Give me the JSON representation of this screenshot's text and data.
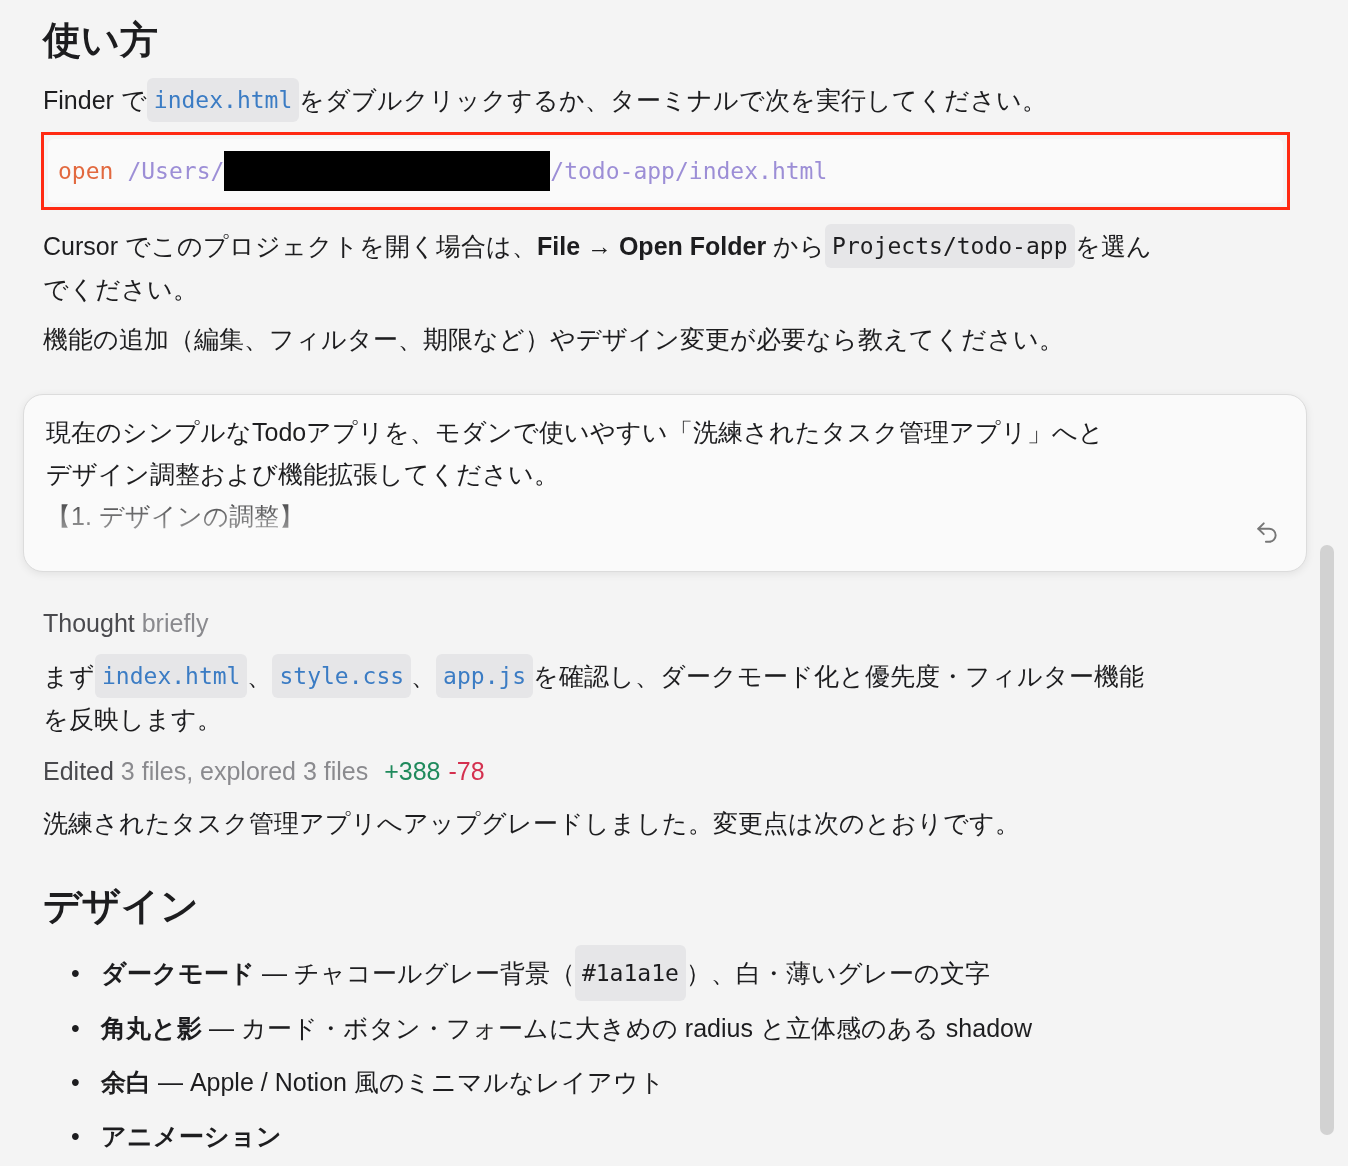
{
  "usage": {
    "heading": "使い方",
    "intro": [
      [
        {
          "kind": "text",
          "text": "Finder で "
        },
        {
          "kind": "code",
          "text": "index.html"
        },
        {
          "kind": "text",
          "text": " をダブルクリックするか、ターミナルで次を実行してください。"
        }
      ]
    ],
    "command": {
      "highlighted": true,
      "keyword": "open",
      "path_start": "/Users/",
      "path_end": "/todo-app/index.html"
    },
    "paragraphs": [
      [
        [
          {
            "kind": "text",
            "text": "Cursor でこのプロジェクトを開く場合は、**File → Open Folder** から "
          },
          {
            "kind": "code_plain",
            "text": "Projects/todo-app"
          },
          {
            "kind": "text",
            "text": " を選ん"
          }
        ],
        [
          {
            "kind": "text",
            "text": "でください。"
          }
        ]
      ],
      [
        [
          {
            "kind": "text",
            "text": "機能の追加（編集、フィルター、期限など）やデザイン変更が必要なら教えてください。"
          }
        ]
      ]
    ]
  },
  "prompt": {
    "lines": [
      "現在のシンプルなTodoアプリを、モダンで使いやすい「洗練されたタスク管理アプリ」へと",
      "デザイン調整および機能拡張してください。",
      "【1. デザインの調整】"
    ]
  },
  "thought": {
    "label": "Thought",
    "detail": "briefly"
  },
  "plan": [
    [
      {
        "kind": "text",
        "text": "まず "
      },
      {
        "kind": "code",
        "text": "index.html"
      },
      {
        "kind": "text",
        "text": "、"
      },
      {
        "kind": "code",
        "text": "style.css"
      },
      {
        "kind": "text",
        "text": "、"
      },
      {
        "kind": "code",
        "text": "app.js"
      },
      {
        "kind": "text",
        "text": " を確認し、ダークモード化と優先度・フィルター機能"
      }
    ],
    [
      {
        "kind": "text",
        "text": "を反映します。"
      }
    ]
  ],
  "edits": {
    "label": "Edited",
    "detail": "3 files, explored 3 files",
    "added": "+388",
    "removed": "-78"
  },
  "summary": "洗練されたタスク管理アプリへアップグレードしました。変更点は次のとおりです。",
  "design": {
    "heading": "デザイン",
    "bullets": [
      {
        "marker": "•",
        "parts": [
          {
            "kind": "text",
            "text": "**ダークモード** — チャコールグレー背景（"
          },
          {
            "kind": "code_plain",
            "text": "#1a1a1e"
          },
          {
            "kind": "text",
            "text": "）、白・薄いグレーの文字"
          }
        ]
      },
      {
        "marker": "•",
        "parts": [
          {
            "kind": "text",
            "text": "**角丸と影** — カード・ボタン・フォームに大きめの radius と立体感のある shadow"
          }
        ]
      },
      {
        "marker": "•",
        "parts": [
          {
            "kind": "text",
            "text": "**余白** — Apple / Notion 風のミニマルなレイアウト"
          }
        ]
      },
      {
        "marker": "•",
        "parts": [
          {
            "kind": "text",
            "text": "**アニメーション**"
          }
        ]
      }
    ]
  }
}
